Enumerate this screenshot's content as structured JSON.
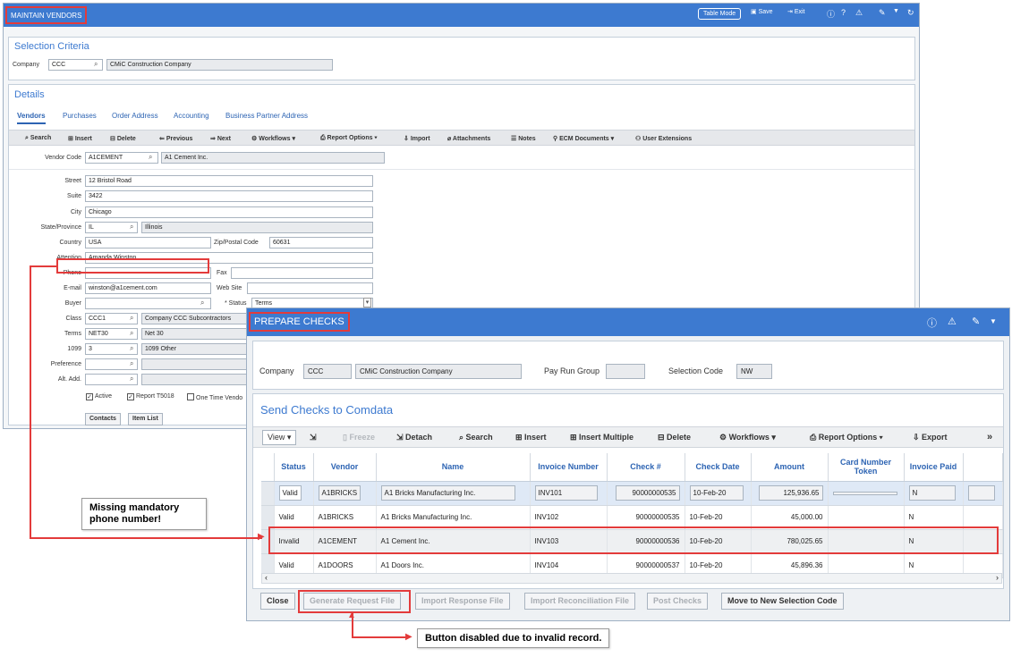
{
  "win1": {
    "title": "MAINTAIN VENDORS",
    "toolbar": {
      "table_mode": "Table Mode",
      "save": "Save",
      "exit": "Exit"
    },
    "selection": {
      "title": "Selection Criteria",
      "company_label": "Company",
      "company_code": "CCC",
      "company_name": "CMiC Construction Company"
    },
    "details": {
      "title": "Details",
      "tabs": [
        "Vendors",
        "Purchases",
        "Order Address",
        "Accounting",
        "Business Partner Address"
      ],
      "tools": [
        "Search",
        "Insert",
        "Delete",
        "Previous",
        "Next",
        "Workflows",
        "Report Options",
        "Import",
        "Attachments",
        "Notes",
        "ECM Documents",
        "User Extensions"
      ],
      "vendor_code_label": "Vendor Code",
      "vendor_code": "A1CEMENT",
      "vendor_name": "A1 Cement Inc.",
      "street_label": "Street",
      "street": "12 Bristol Road",
      "suite_label": "Suite",
      "suite": "3422",
      "city_label": "City",
      "city": "Chicago",
      "state_label": "State/Province",
      "state": "IL",
      "state_name": "Illinois",
      "country_label": "Country",
      "country": "USA",
      "zip_label": "Zip/Postal Code",
      "zip": "60631",
      "attention_label": "Attention",
      "attention": "Amanda Winston",
      "phone_label": "Phone",
      "phone": "",
      "fax_label": "Fax",
      "fax": "",
      "email_label": "E-mail",
      "email": "winston@a1cement.com",
      "website_label": "Web Site",
      "website": "",
      "buyer_label": "Buyer",
      "buyer": "",
      "status_label": "* Status",
      "status": "Terms",
      "class_label": "Class",
      "class": "CCC1",
      "class_name": "Company CCC Subcontractors",
      "terms_label": "Terms",
      "terms": "NET30",
      "terms_name": "Net 30",
      "t1099_label": "1099",
      "t1099": "3",
      "t1099_name": "1099 Other",
      "preference_label": "Preference",
      "altadd_label": "Alt. Add.",
      "active_label": "Active",
      "report_label": "Report T5018",
      "onetime_label": "One Time Vendo",
      "contacts_btn": "Contacts",
      "itemlist_btn": "Item List"
    }
  },
  "win2": {
    "title": "PREPARE CHECKS",
    "company_label": "Company",
    "company_code": "CCC",
    "company_name": "CMiC Construction Company",
    "payrun_label": "Pay Run Group",
    "payrun_value": "",
    "selcode_label": "Selection Code",
    "selcode_value": "NW",
    "grid_title": "Send Checks to Comdata",
    "tools": {
      "view": "View",
      "freeze": "Freeze",
      "detach": "Detach",
      "search": "Search",
      "insert": "Insert",
      "insert_multiple": "Insert Multiple",
      "delete": "Delete",
      "workflows": "Workflows",
      "report_options": "Report Options",
      "export": "Export"
    },
    "columns": [
      "Status",
      "Vendor",
      "Name",
      "Invoice Number",
      "Check #",
      "Check Date",
      "Amount",
      "Card Number Token",
      "Invoice Paid"
    ],
    "rows": [
      {
        "status": "Valid",
        "vendor": "A1BRICKS",
        "name": "A1 Bricks Manufacturing Inc.",
        "invoice": "INV101",
        "check": "90000000535",
        "date": "10-Feb-20",
        "amount": "125,936.65",
        "token": "",
        "paid": "N"
      },
      {
        "status": "Valid",
        "vendor": "A1BRICKS",
        "name": "A1 Bricks Manufacturing Inc.",
        "invoice": "INV102",
        "check": "90000000535",
        "date": "10-Feb-20",
        "amount": "45,000.00",
        "token": "",
        "paid": "N"
      },
      {
        "status": "Invalid",
        "vendor": "A1CEMENT",
        "name": "A1 Cement Inc.",
        "invoice": "INV103",
        "check": "90000000536",
        "date": "10-Feb-20",
        "amount": "780,025.65",
        "token": "",
        "paid": "N"
      },
      {
        "status": "Valid",
        "vendor": "A1DOORS",
        "name": "A1 Doors Inc.",
        "invoice": "INV104",
        "check": "90000000537",
        "date": "10-Feb-20",
        "amount": "45,896.36",
        "token": "",
        "paid": "N"
      }
    ],
    "buttons": {
      "close": "Close",
      "generate": "Generate Request File",
      "import_response": "Import Response File",
      "import_recon": "Import Reconciliation File",
      "post": "Post Checks",
      "move": "Move to New Selection Code"
    }
  },
  "callouts": {
    "phone_missing": "Missing mandatory\nphone number!",
    "button_disabled": "Button disabled due to invalid record."
  },
  "colors": {
    "title_bar": "#3d7ad0",
    "highlight": "#e33b3b",
    "link": "#2d64b3"
  }
}
